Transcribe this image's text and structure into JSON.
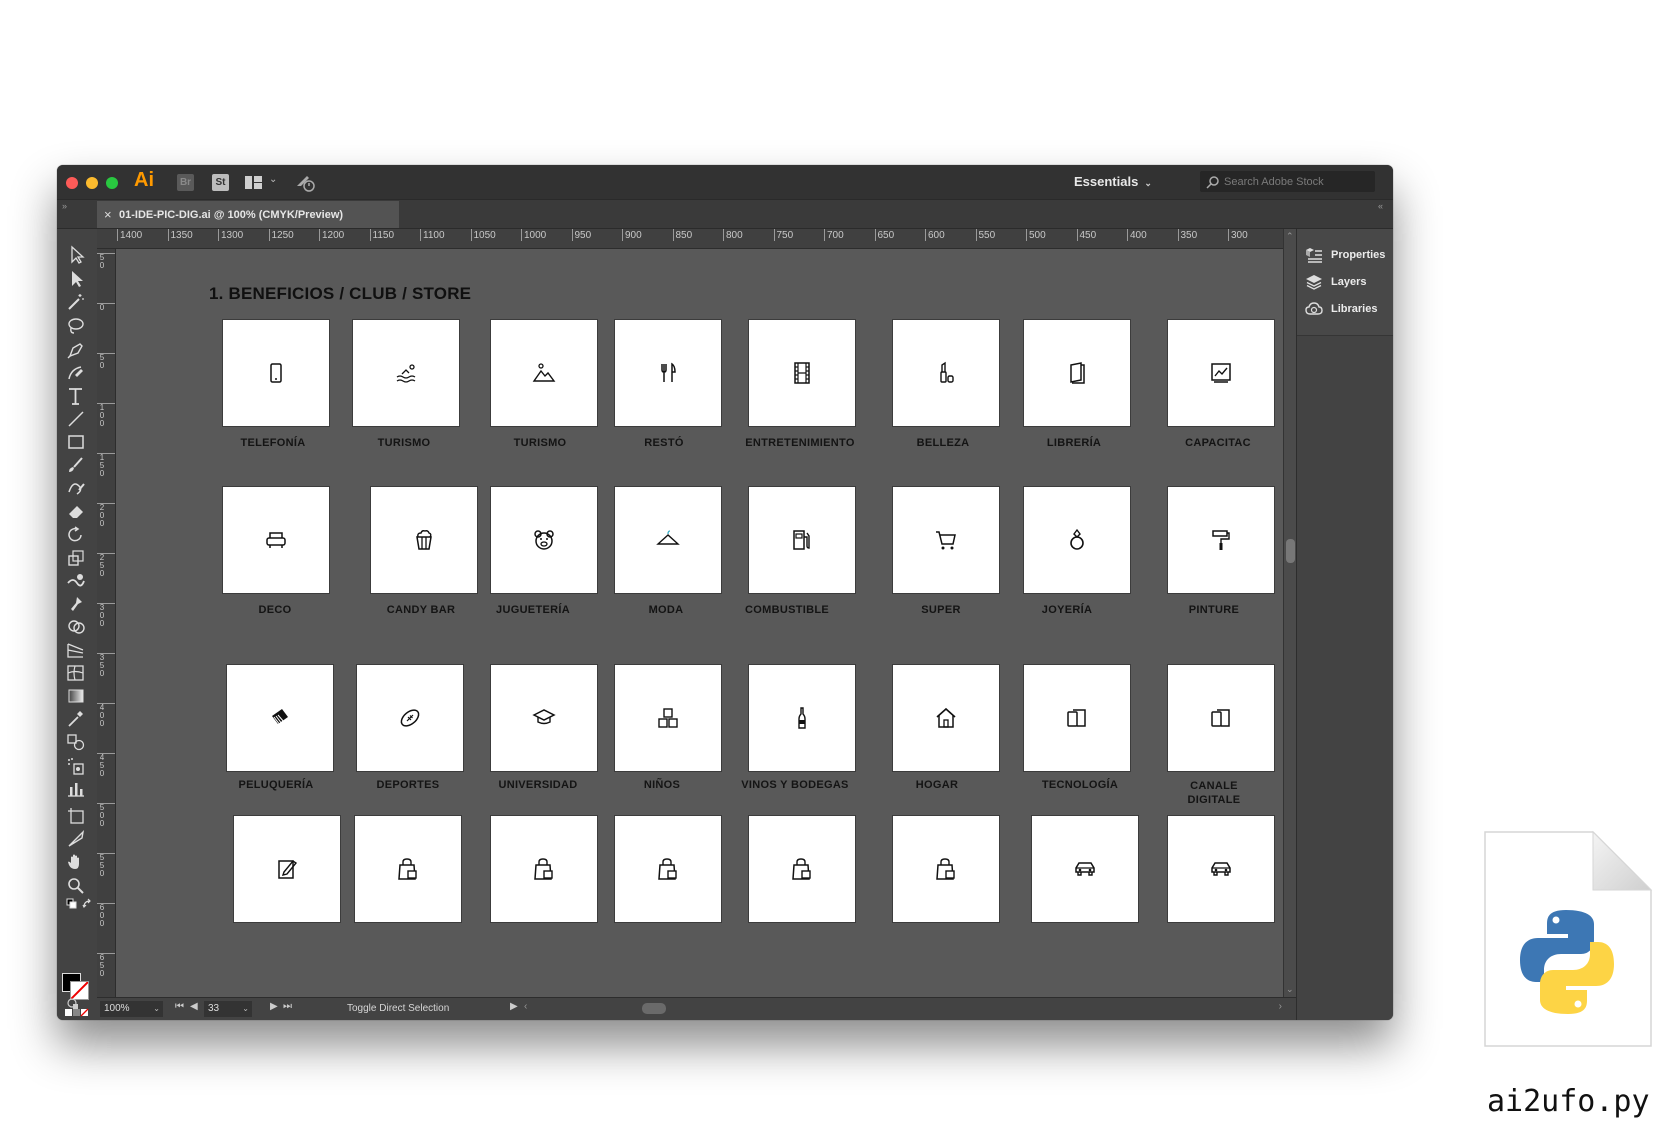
{
  "window": {
    "app_logo": "Ai",
    "bridge_label": "Br",
    "stock_label": "St",
    "workspace": "Essentials",
    "search": {
      "placeholder": "Search Adobe Stock"
    }
  },
  "document_tab": {
    "close": "×",
    "title": "01-IDE-PIC-DIG.ai @ 100% (CMYK/Preview)"
  },
  "ruler": {
    "horizontal": [
      "1400",
      "1350",
      "1300",
      "1250",
      "1200",
      "1150",
      "1100",
      "1050",
      "1000",
      "950",
      "900",
      "850",
      "800",
      "750",
      "700",
      "650",
      "600",
      "550",
      "500",
      "450",
      "400",
      "350",
      "300"
    ],
    "vertical": [
      "50",
      "0",
      "50",
      "100",
      "150",
      "200",
      "250",
      "300",
      "350",
      "400",
      "450",
      "500",
      "550",
      "600",
      "650"
    ]
  },
  "canvas": {
    "section_title": "1. BENEFICIOS / CLUB / STORE",
    "rows": [
      [
        {
          "label": "TELEFONÍA",
          "icon": "phone-icon"
        },
        {
          "label": "TURISMO",
          "icon": "beach-icon"
        },
        {
          "label": "TURISMO",
          "icon": "mountain-icon"
        },
        {
          "label": "RESTÓ",
          "icon": "cutlery-icon"
        },
        {
          "label": "ENTRETENIMIENTO",
          "icon": "film-icon"
        },
        {
          "label": "BELLEZA",
          "icon": "cosmetics-icon"
        },
        {
          "label": "LIBRERÍA",
          "icon": "book-icon"
        },
        {
          "label": "CAPACITAC",
          "icon": "chart-board-icon"
        }
      ],
      [
        {
          "label": "DECO",
          "icon": "armchair-icon"
        },
        {
          "label": "CANDY BAR",
          "icon": "popcorn-icon"
        },
        {
          "label": "JUGUETERÍA",
          "icon": "teddy-bear-icon"
        },
        {
          "label": "MODA",
          "icon": "hanger-icon"
        },
        {
          "label": "COMBUSTIBLE",
          "icon": "fuel-pump-icon"
        },
        {
          "label": "SUPER",
          "icon": "cart-icon"
        },
        {
          "label": "JOYERÍA",
          "icon": "ring-icon"
        },
        {
          "label": "PINTURE",
          "icon": "paint-roller-icon"
        }
      ],
      [
        {
          "label": "PELUQUERÍA",
          "icon": "comb-icon"
        },
        {
          "label": "DEPORTES",
          "icon": "football-icon"
        },
        {
          "label": "UNIVERSIDAD",
          "icon": "graduation-cap-icon"
        },
        {
          "label": "NIÑOS",
          "icon": "blocks-icon"
        },
        {
          "label": "VINOS Y BODEGAS",
          "icon": "wine-bottle-icon"
        },
        {
          "label": "HOGAR",
          "icon": "house-icon"
        },
        {
          "label": "TECNOLOGÍA",
          "icon": "devices-icon"
        },
        {
          "label": "CANALE DIGITALE",
          "icon": "devices-icon"
        }
      ],
      [
        {
          "label": "",
          "icon": "edit-note-icon"
        },
        {
          "label": "",
          "icon": "shopping-bag-icon"
        },
        {
          "label": "",
          "icon": "shopping-bag-icon"
        },
        {
          "label": "",
          "icon": "shopping-bag-icon"
        },
        {
          "label": "",
          "icon": "shopping-bag-icon"
        },
        {
          "label": "",
          "icon": "shopping-bag-icon"
        },
        {
          "label": "",
          "icon": "car-icon"
        },
        {
          "label": "",
          "icon": "car-icon"
        }
      ]
    ]
  },
  "statusbar": {
    "zoom": "100%",
    "page": "33",
    "status_text": "Toggle Direct Selection"
  },
  "panels": {
    "items": [
      "Properties",
      "Layers",
      "Libraries"
    ]
  },
  "script_name": "ai2ufo.py",
  "colors": {
    "app_chrome": "#535353",
    "ai_orange": "#ff9a00",
    "python_blue": "#3d77b4",
    "python_yellow": "#fdd445"
  }
}
